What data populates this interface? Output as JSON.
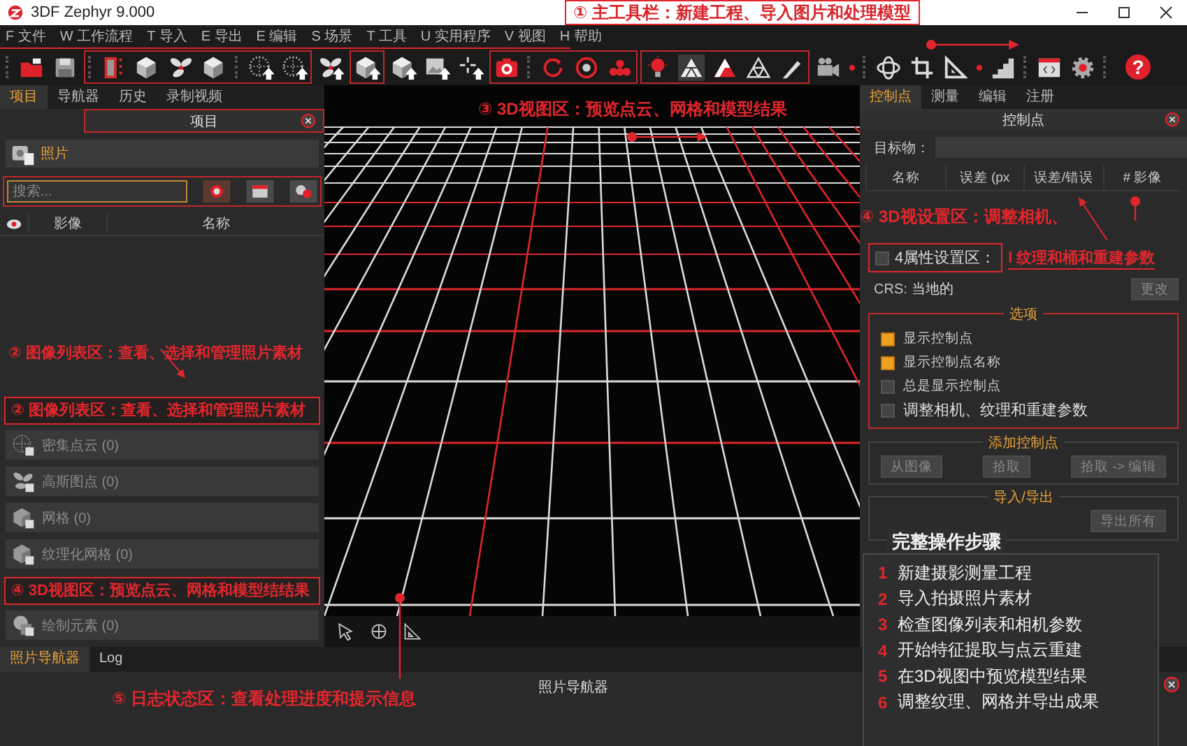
{
  "window": {
    "title": "3DF Zephyr 9.000"
  },
  "toolbar_callout": "① 主工具栏：新建工程、导入图片和处理模型",
  "menu": [
    "F 文件",
    "W 工作流程",
    "T 导入",
    "E 导出",
    "E 编辑",
    "S 场景",
    "T 工具",
    "U 实用程序",
    "V 视图",
    "H 帮助"
  ],
  "help_button": "?",
  "left_panel": {
    "tabs": [
      {
        "label": "项目",
        "selected": true
      },
      {
        "label": "导航器",
        "selected": false
      },
      {
        "label": "历史",
        "selected": false
      },
      {
        "label": "录制视频",
        "selected": false
      }
    ],
    "title": "项目",
    "photos_label": "照片",
    "search": {
      "placeholder": "搜索..."
    },
    "columns": [
      "影像",
      "名称"
    ],
    "list_callout": "② 图像列表区：查看、选择和管理照片素材",
    "boxed_callout": "② 图像列表区：查看、选择和管理照片素材",
    "items": [
      {
        "kind": "section",
        "label": "密集点云 (0)"
      },
      {
        "kind": "section",
        "label": "高斯图点 (0)"
      },
      {
        "kind": "section",
        "label": "网格 (0)"
      },
      {
        "kind": "section",
        "label": "纹理化网格 (0)"
      },
      {
        "kind": "callout",
        "label": "④ 3D视图区：预览点云、网格和模型结结果"
      },
      {
        "kind": "section",
        "label": "绘制元素 (0)"
      }
    ]
  },
  "view": {
    "callout": "③ 3D视图区：预览点云、网格和模型结果"
  },
  "right_panel": {
    "tabs": [
      {
        "label": "控制点",
        "selected": true
      },
      {
        "label": "测量",
        "selected": false
      },
      {
        "label": "编辑",
        "selected": false
      },
      {
        "label": "注册",
        "selected": false
      }
    ],
    "title": "控制点",
    "target_label": "目标物：",
    "columns": [
      "名称",
      "误差 (px",
      "误差/错误",
      "# 影像"
    ],
    "callout": "④ 3D视设置区：调整相机、",
    "property": {
      "label": "4属性设置区：",
      "checked": false
    },
    "property_note": "l 纹理和桶和重建参数",
    "crs_label": "CRS:",
    "crs_value": "当地的",
    "change_button": "更改",
    "options": {
      "title": "选项",
      "items": [
        {
          "label": "显示控制点",
          "checked": true
        },
        {
          "label": "显示控制点名称",
          "checked": true
        },
        {
          "label": "总是显示控制点",
          "checked": false
        },
        {
          "label": "调整相机、纹理和重建参数",
          "checked": false
        }
      ]
    },
    "add_points": {
      "title": "添加控制点",
      "buttons": [
        "从图像",
        "拾取",
        "拾取 -> 编辑"
      ]
    },
    "import_export": {
      "title": "导入/导出",
      "buttons": [
        "导出所有"
      ]
    }
  },
  "steps_card": {
    "title": "完整操作步骤",
    "steps": [
      {
        "number": "1",
        "text": "新建摄影测量工程"
      },
      {
        "number": "2",
        "text": "导入拍摄照片素材"
      },
      {
        "number": "3",
        "text": "检查图像列表和相机参数"
      },
      {
        "number": "4",
        "text": "开始特征提取与点云重建"
      },
      {
        "number": "5",
        "text": "在3D视图中预览模型结果"
      },
      {
        "number": "6",
        "text": "调整纹理、网格并导出成果"
      }
    ]
  },
  "bottom": {
    "tabs": [
      {
        "label": "照片导航器",
        "selected": true
      },
      {
        "label": "Log",
        "selected": false
      }
    ],
    "title": "照片导航器",
    "callout": "⑤ 日志状态区：查看处理进度和提示信息"
  }
}
